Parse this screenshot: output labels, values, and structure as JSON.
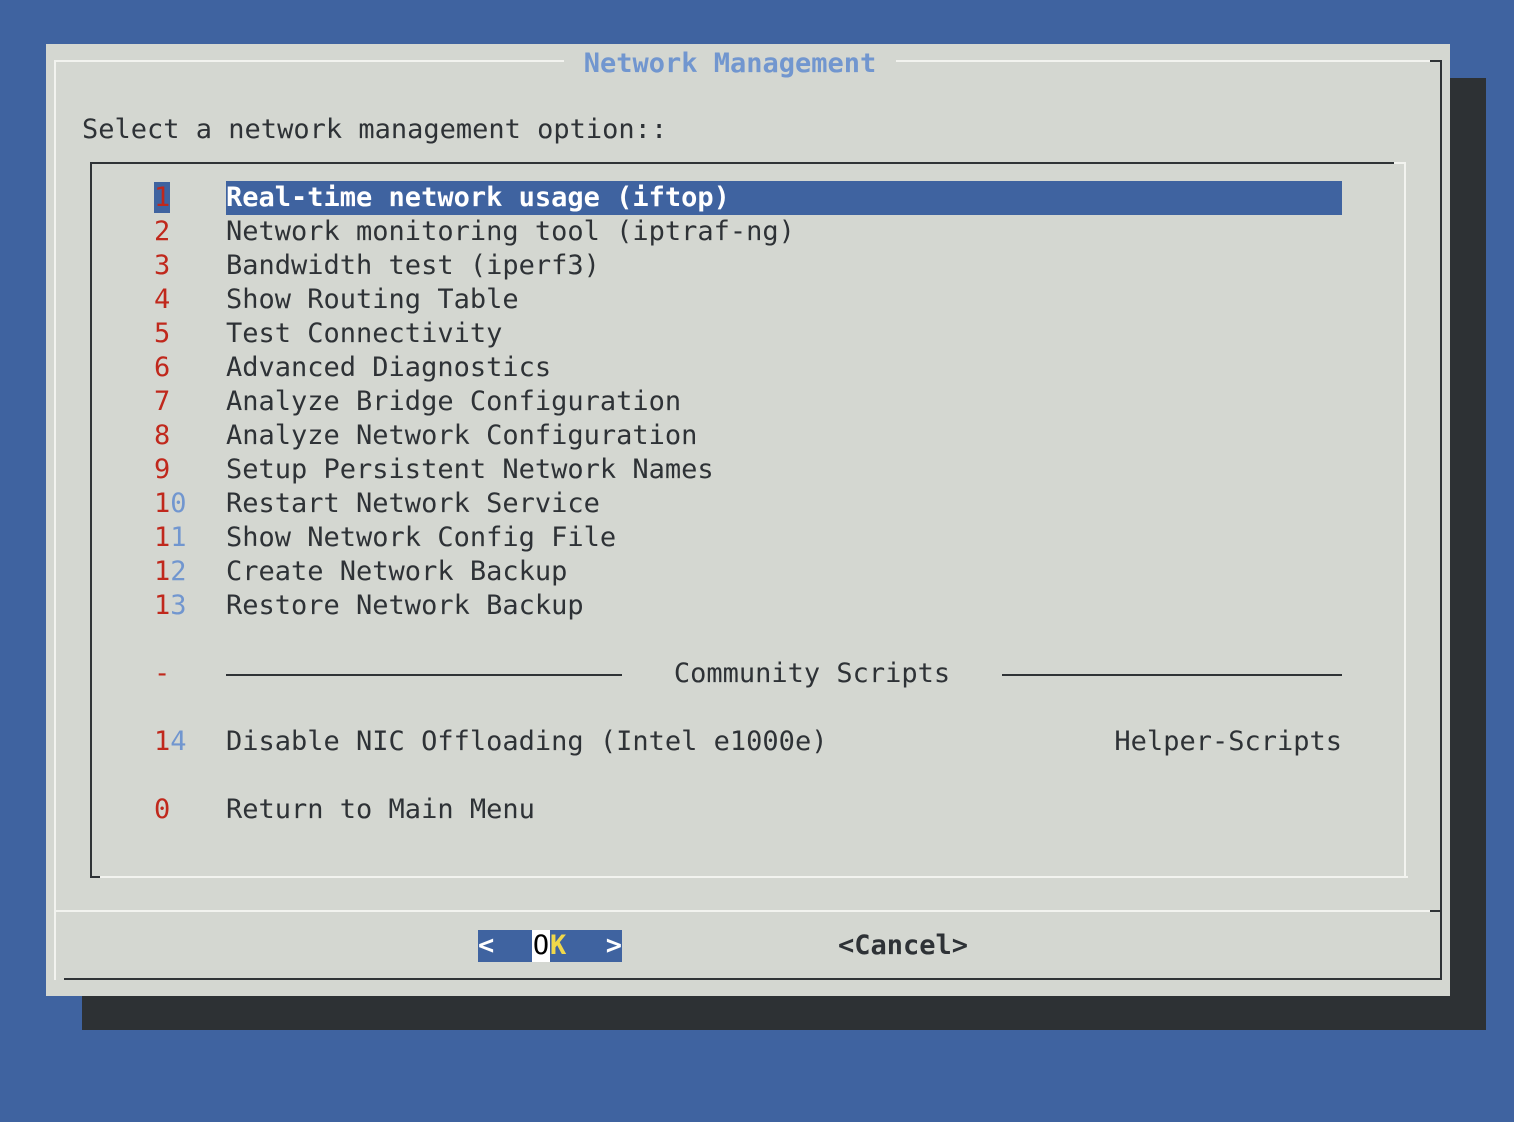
{
  "dialog": {
    "title": "Network Management",
    "prompt": "Select a network management option::"
  },
  "menu": {
    "selected_index": 0,
    "items": [
      {
        "num_a": "1",
        "num_b": "",
        "label": "Real-time network usage (iftop)",
        "tag": ""
      },
      {
        "num_a": "2",
        "num_b": "",
        "label": "Network monitoring tool (iptraf-ng)",
        "tag": ""
      },
      {
        "num_a": "3",
        "num_b": "",
        "label": "Bandwidth test (iperf3)",
        "tag": ""
      },
      {
        "num_a": "4",
        "num_b": "",
        "label": "Show Routing Table",
        "tag": ""
      },
      {
        "num_a": "5",
        "num_b": "",
        "label": "Test Connectivity",
        "tag": ""
      },
      {
        "num_a": "6",
        "num_b": "",
        "label": "Advanced Diagnostics",
        "tag": ""
      },
      {
        "num_a": "7",
        "num_b": "",
        "label": "Analyze Bridge Configuration",
        "tag": ""
      },
      {
        "num_a": "8",
        "num_b": "",
        "label": "Analyze Network Configuration",
        "tag": ""
      },
      {
        "num_a": "9",
        "num_b": "",
        "label": "Setup Persistent Network Names",
        "tag": ""
      },
      {
        "num_a": "1",
        "num_b": "0",
        "label": "Restart Network Service",
        "tag": ""
      },
      {
        "num_a": "1",
        "num_b": "1",
        "label": "Show Network Config File",
        "tag": ""
      },
      {
        "num_a": "1",
        "num_b": "2",
        "label": "Create Network Backup",
        "tag": ""
      },
      {
        "num_a": "1",
        "num_b": "3",
        "label": "Restore Network Backup",
        "tag": ""
      }
    ],
    "separator": {
      "num": "-",
      "label": "Community Scripts"
    },
    "community": {
      "num_a": "1",
      "num_b": "4",
      "label": "Disable NIC Offloading (Intel e1000e)",
      "tag": "Helper-Scripts"
    },
    "return": {
      "num_a": "0",
      "num_b": "",
      "label": "Return to Main Menu"
    }
  },
  "buttons": {
    "ok_left": "<",
    "ok_first": "O",
    "ok_rest": "K",
    "ok_right": ">",
    "cancel": "<Cancel>"
  },
  "colors": {
    "background": "#3f63a0",
    "dialog": "#d4d7d1",
    "hotkey": "#c0281c",
    "accent": "#7196cf",
    "selection": "#3f63a0"
  }
}
